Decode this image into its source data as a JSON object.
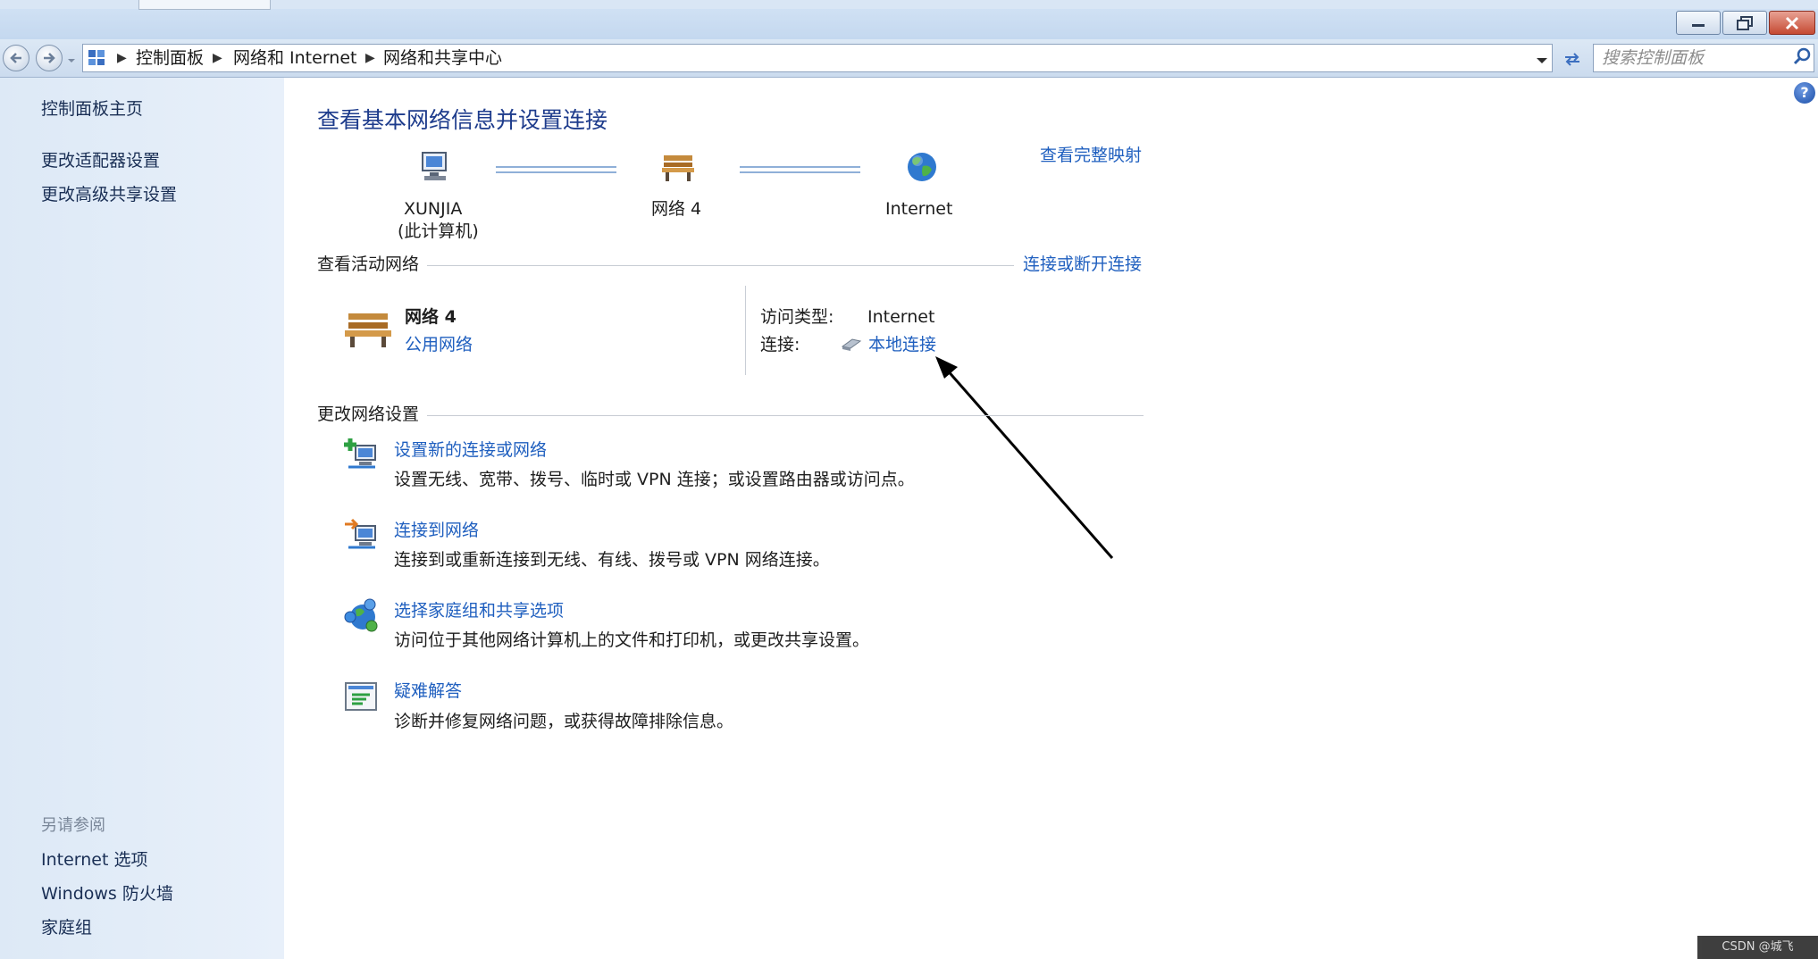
{
  "window": {
    "minimize_icon": "minimize-icon",
    "restore_icon": "restore-icon",
    "close_icon": "close-icon"
  },
  "address": {
    "breadcrumbs": [
      "控制面板",
      "网络和 Internet",
      "网络和共享中心"
    ],
    "search_placeholder": "搜索控制面板"
  },
  "sidebar": {
    "items": [
      "控制面板主页",
      "更改适配器设置",
      "更改高级共享设置"
    ],
    "see_also_title": "另请参阅",
    "see_also": [
      "Internet 选项",
      "Windows 防火墙",
      "家庭组"
    ]
  },
  "main": {
    "title": "查看基本网络信息并设置连接",
    "full_map_link": "查看完整映射",
    "map": {
      "computer_name": "XUNJIA",
      "computer_sub": "(此计算机)",
      "network": "网络  4",
      "internet": "Internet"
    },
    "active_networks": {
      "heading": "查看活动网络",
      "connect_link": "连接或断开连接",
      "network_name": "网络  4",
      "network_type": "公用网络",
      "access_type_label": "访问类型:",
      "access_type_value": "Internet",
      "connection_label": "连接:",
      "connection_value": "本地连接"
    },
    "change_settings": {
      "heading": "更改网络设置",
      "tasks": [
        {
          "title": "设置新的连接或网络",
          "desc": "设置无线、宽带、拨号、临时或 VPN 连接；或设置路由器或访问点。",
          "icon": "new-connection-icon"
        },
        {
          "title": "连接到网络",
          "desc": "连接到或重新连接到无线、有线、拨号或 VPN 网络连接。",
          "icon": "connect-network-icon"
        },
        {
          "title": "选择家庭组和共享选项",
          "desc": "访问位于其他网络计算机上的文件和打印机，或更改共享设置。",
          "icon": "homegroup-icon"
        },
        {
          "title": "疑难解答",
          "desc": "诊断并修复网络问题，或获得故障排除信息。",
          "icon": "troubleshoot-icon"
        }
      ]
    }
  },
  "watermark": "CSDN @城飞"
}
